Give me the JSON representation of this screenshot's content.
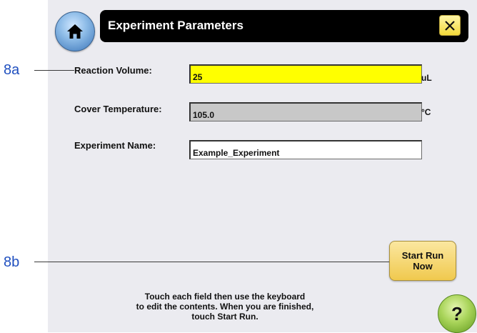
{
  "header": {
    "title": "Experiment Parameters",
    "home_icon": "home-icon",
    "close_icon": "close-icon"
  },
  "callouts": {
    "a": "8a",
    "b": "8b"
  },
  "fields": {
    "reaction_volume": {
      "label": "Reaction Volume:",
      "value": "25",
      "unit": "uL",
      "highlight": "#ffff00"
    },
    "cover_temperature": {
      "label": "Cover Temperature:",
      "value": "105.0",
      "unit": "°C",
      "background": "#c8c8c8"
    },
    "experiment_name": {
      "label": "Experiment Name:",
      "value": "Example_Experiment",
      "background": "#ffffff"
    }
  },
  "actions": {
    "start_run_line1": "Start Run",
    "start_run_line2": "Now"
  },
  "instructions": {
    "line1": "Touch each field then use the keyboard",
    "line2": "to edit the contents. When you are finished,",
    "line3": "touch Start Run."
  },
  "help": {
    "label": "?"
  }
}
